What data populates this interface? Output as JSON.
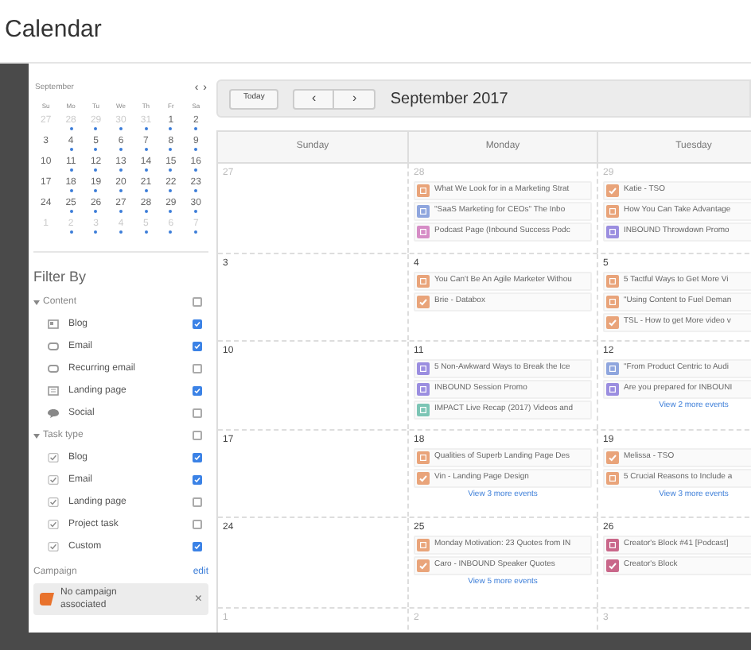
{
  "header": {
    "title": "Calendar"
  },
  "mini_calendar": {
    "month": "September",
    "prev": "‹",
    "next": "›",
    "weekdays": [
      "Su",
      "Mo",
      "Tu",
      "We",
      "Th",
      "Fr",
      "Sa"
    ],
    "weeks": [
      [
        {
          "day": "27",
          "muted": true,
          "dot": false
        },
        {
          "day": "28",
          "muted": true,
          "dot": true
        },
        {
          "day": "29",
          "muted": true,
          "dot": true
        },
        {
          "day": "30",
          "muted": true,
          "dot": true
        },
        {
          "day": "31",
          "muted": true,
          "dot": true
        },
        {
          "day": "1",
          "muted": false,
          "dot": true
        },
        {
          "day": "2",
          "muted": false,
          "dot": true
        }
      ],
      [
        {
          "day": "3",
          "muted": false,
          "dot": false
        },
        {
          "day": "4",
          "muted": false,
          "dot": true
        },
        {
          "day": "5",
          "muted": false,
          "dot": true
        },
        {
          "day": "6",
          "muted": false,
          "dot": true
        },
        {
          "day": "7",
          "muted": false,
          "dot": true
        },
        {
          "day": "8",
          "muted": false,
          "dot": true
        },
        {
          "day": "9",
          "muted": false,
          "dot": true
        }
      ],
      [
        {
          "day": "10",
          "muted": false,
          "dot": false
        },
        {
          "day": "11",
          "muted": false,
          "dot": true
        },
        {
          "day": "12",
          "muted": false,
          "dot": true
        },
        {
          "day": "13",
          "muted": false,
          "dot": true
        },
        {
          "day": "14",
          "muted": false,
          "dot": true
        },
        {
          "day": "15",
          "muted": false,
          "dot": true
        },
        {
          "day": "16",
          "muted": false,
          "dot": true
        }
      ],
      [
        {
          "day": "17",
          "muted": false,
          "dot": false
        },
        {
          "day": "18",
          "muted": false,
          "dot": true
        },
        {
          "day": "19",
          "muted": false,
          "dot": true
        },
        {
          "day": "20",
          "muted": false,
          "dot": true
        },
        {
          "day": "21",
          "muted": false,
          "dot": true
        },
        {
          "day": "22",
          "muted": false,
          "dot": true
        },
        {
          "day": "23",
          "muted": false,
          "dot": true
        }
      ],
      [
        {
          "day": "24",
          "muted": false,
          "dot": false
        },
        {
          "day": "25",
          "muted": false,
          "dot": true
        },
        {
          "day": "26",
          "muted": false,
          "dot": true
        },
        {
          "day": "27",
          "muted": false,
          "dot": true
        },
        {
          "day": "28",
          "muted": false,
          "dot": true
        },
        {
          "day": "29",
          "muted": false,
          "dot": true
        },
        {
          "day": "30",
          "muted": false,
          "dot": true
        }
      ],
      [
        {
          "day": "1",
          "muted": true,
          "dot": false
        },
        {
          "day": "2",
          "muted": true,
          "dot": true
        },
        {
          "day": "3",
          "muted": true,
          "dot": true
        },
        {
          "day": "4",
          "muted": true,
          "dot": true
        },
        {
          "day": "5",
          "muted": true,
          "dot": true
        },
        {
          "day": "6",
          "muted": true,
          "dot": true
        },
        {
          "day": "7",
          "muted": true,
          "dot": true
        }
      ]
    ]
  },
  "filter": {
    "title": "Filter By",
    "groups": [
      {
        "label": "Content",
        "expanded": true,
        "checked": false,
        "items": [
          {
            "label": "Blog",
            "kind": "content",
            "checked": true
          },
          {
            "label": "Email",
            "kind": "content",
            "checked": true
          },
          {
            "label": "Recurring email",
            "kind": "content",
            "checked": false
          },
          {
            "label": "Landing page",
            "kind": "content",
            "checked": true
          },
          {
            "label": "Social",
            "kind": "content",
            "checked": false
          }
        ]
      },
      {
        "label": "Task type",
        "expanded": true,
        "checked": false,
        "items": [
          {
            "label": "Blog",
            "kind": "task",
            "checked": true
          },
          {
            "label": "Email",
            "kind": "task",
            "checked": true
          },
          {
            "label": "Landing page",
            "kind": "task",
            "checked": false
          },
          {
            "label": "Project task",
            "kind": "task",
            "checked": false
          },
          {
            "label": "Custom",
            "kind": "task",
            "checked": true
          }
        ]
      }
    ]
  },
  "campaign": {
    "label": "Campaign",
    "edit": "edit",
    "value": "No campaign associated",
    "clear": "×"
  },
  "toolbar": {
    "today": "Today",
    "prev": "‹",
    "next": "›",
    "title": "September 2017"
  },
  "calendar": {
    "columns": [
      "Sunday",
      "Monday",
      "Tuesday"
    ],
    "weeks": [
      [
        {
          "day": "27",
          "muted": true
        },
        {
          "day": "28",
          "muted": true,
          "events": [
            {
              "kind": "content",
              "color": "#e9a47a",
              "title": "What We Look for in a Marketing Strat"
            },
            {
              "kind": "content",
              "color": "#8fa6de",
              "title": "\"SaaS Marketing for CEOs\" The Inbo"
            },
            {
              "kind": "content",
              "color": "#d68cc6",
              "title": "Podcast Page (Inbound Success Podc"
            }
          ]
        },
        {
          "day": "29",
          "muted": true,
          "events": [
            {
              "kind": "task",
              "color": "#e9a47a",
              "title": "Katie - TSO"
            },
            {
              "kind": "content",
              "color": "#e9a47a",
              "title": "How You Can Take Advantage"
            },
            {
              "kind": "content",
              "color": "#9b8ee0",
              "title": "INBOUND Throwdown Promo"
            }
          ]
        }
      ],
      [
        {
          "day": "3",
          "muted": false
        },
        {
          "day": "4",
          "muted": false,
          "events": [
            {
              "kind": "content",
              "color": "#e9a47a",
              "title": "You Can't Be An Agile Marketer Withou"
            },
            {
              "kind": "task",
              "color": "#e9a47a",
              "title": "Brie - Databox"
            }
          ]
        },
        {
          "day": "5",
          "muted": false,
          "events": [
            {
              "kind": "content",
              "color": "#e9a47a",
              "title": "5 Tactful Ways to Get More Vi"
            },
            {
              "kind": "content",
              "color": "#e9a47a",
              "title": "\"Using Content to Fuel Deman"
            },
            {
              "kind": "task",
              "color": "#e9a47a",
              "title": "TSL - How to get More video v"
            }
          ]
        }
      ],
      [
        {
          "day": "10",
          "muted": false
        },
        {
          "day": "11",
          "muted": false,
          "events": [
            {
              "kind": "content",
              "color": "#9b8ee0",
              "title": "5 Non-Awkward Ways to Break the Ice"
            },
            {
              "kind": "content",
              "color": "#9b8ee0",
              "title": "INBOUND Session Promo"
            },
            {
              "kind": "content",
              "color": "#7cc5b5",
              "title": "IMPACT Live Recap (2017) Videos and"
            }
          ]
        },
        {
          "day": "12",
          "muted": false,
          "more": "View 2 more events",
          "events": [
            {
              "kind": "content",
              "color": "#8fa6de",
              "title": "\"From Product Centric to Audi"
            },
            {
              "kind": "content",
              "color": "#9b8ee0",
              "title": "Are you prepared for INBOUNI"
            }
          ]
        }
      ],
      [
        {
          "day": "17",
          "muted": false
        },
        {
          "day": "18",
          "muted": false,
          "more": "View 3 more events",
          "events": [
            {
              "kind": "content",
              "color": "#e9a47a",
              "title": "Qualities of Superb Landing Page Des"
            },
            {
              "kind": "task",
              "color": "#e9a47a",
              "title": "Vin - Landing Page Design"
            }
          ]
        },
        {
          "day": "19",
          "muted": false,
          "more": "View 3 more events",
          "events": [
            {
              "kind": "task",
              "color": "#e9a47a",
              "title": "Melissa - TSO"
            },
            {
              "kind": "content",
              "color": "#e9a47a",
              "title": "5 Crucial Reasons to Include a"
            }
          ]
        }
      ],
      [
        {
          "day": "24",
          "muted": false
        },
        {
          "day": "25",
          "muted": false,
          "more": "View 5 more events",
          "events": [
            {
              "kind": "content",
              "color": "#e9a47a",
              "title": "Monday Motivation: 23 Quotes from IN"
            },
            {
              "kind": "task",
              "color": "#e9a47a",
              "title": "Caro - INBOUND Speaker Quotes"
            }
          ]
        },
        {
          "day": "26",
          "muted": false,
          "events": [
            {
              "kind": "content",
              "color": "#c9678a",
              "title": "Creator's Block #41 [Podcast]"
            },
            {
              "kind": "task",
              "color": "#c9678a",
              "title": "Creator's Block"
            }
          ]
        }
      ],
      [
        {
          "day": "1",
          "muted": true
        },
        {
          "day": "2",
          "muted": true
        },
        {
          "day": "3",
          "muted": true
        }
      ]
    ]
  }
}
